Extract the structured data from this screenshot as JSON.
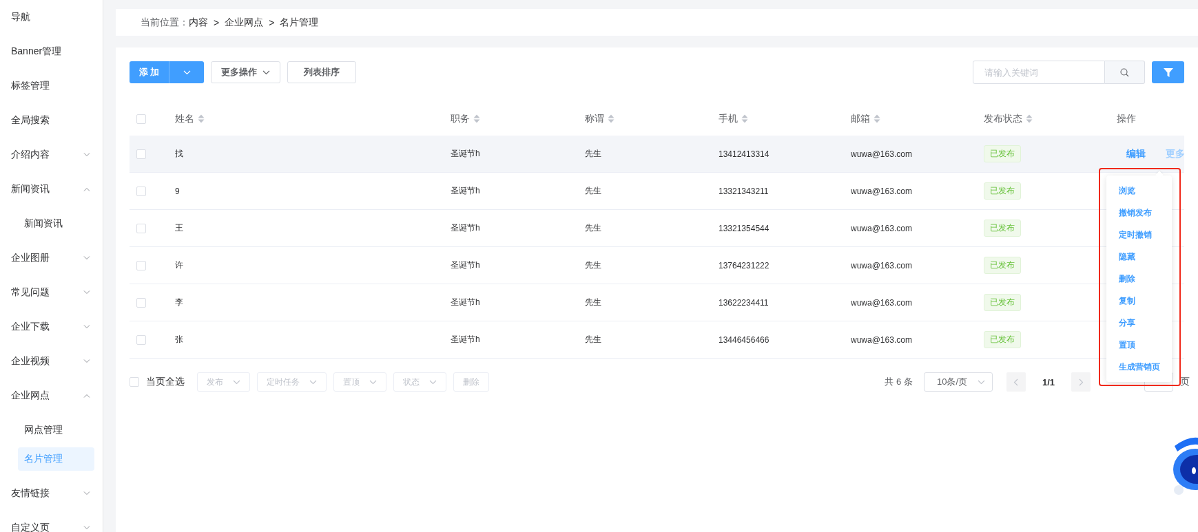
{
  "sidebar": {
    "items": [
      {
        "label": "导航",
        "kind": "link"
      },
      {
        "label": "Banner管理",
        "kind": "link"
      },
      {
        "label": "标签管理",
        "kind": "link"
      },
      {
        "label": "全局搜索",
        "kind": "link"
      },
      {
        "label": "介绍内容",
        "kind": "group",
        "expanded": false
      },
      {
        "label": "新闻资讯",
        "kind": "group",
        "expanded": true,
        "children": [
          {
            "label": "新闻资讯",
            "selected": false
          }
        ]
      },
      {
        "label": "企业图册",
        "kind": "group",
        "expanded": false
      },
      {
        "label": "常见问题",
        "kind": "group",
        "expanded": false
      },
      {
        "label": "企业下载",
        "kind": "group",
        "expanded": false
      },
      {
        "label": "企业视频",
        "kind": "group",
        "expanded": false
      },
      {
        "label": "企业网点",
        "kind": "group",
        "expanded": true,
        "children": [
          {
            "label": "网点管理",
            "selected": false
          },
          {
            "label": "名片管理",
            "selected": true
          }
        ]
      },
      {
        "label": "友情链接",
        "kind": "group",
        "expanded": false
      },
      {
        "label": "自定义页",
        "kind": "group",
        "expanded": false
      }
    ]
  },
  "breadcrumb": {
    "label": "当前位置：",
    "items": [
      "内容",
      "企业网点",
      "名片管理"
    ],
    "separator": ">"
  },
  "toolbar": {
    "add_button": "添 加",
    "more_actions": "更多操作",
    "sort_button": "列表排序",
    "search": {
      "placeholder": "请输入关键词"
    }
  },
  "table": {
    "select_all_checked": false,
    "columns": [
      {
        "label": "姓名",
        "sortable": true
      },
      {
        "label": "职务",
        "sortable": true
      },
      {
        "label": "称谓",
        "sortable": true
      },
      {
        "label": "手机",
        "sortable": true
      },
      {
        "label": "邮箱",
        "sortable": true
      },
      {
        "label": "发布状态",
        "sortable": true
      },
      {
        "label": "操作",
        "sortable": false
      }
    ],
    "rows": [
      {
        "checked": false,
        "hovered": true,
        "cells": [
          "找",
          "圣诞节h",
          "先生",
          "13412413314",
          "wuwa@163.com"
        ],
        "status": "已发布",
        "actions": [
          "编辑",
          "更多"
        ]
      },
      {
        "checked": false,
        "hovered": false,
        "cells": [
          "9",
          "圣诞节h",
          "先生",
          "13321343211",
          "wuwa@163.com"
        ],
        "status": "已发布"
      },
      {
        "checked": false,
        "hovered": false,
        "cells": [
          "王",
          "圣诞节h",
          "先生",
          "13321354544",
          "wuwa@163.com"
        ],
        "status": "已发布"
      },
      {
        "checked": false,
        "hovered": false,
        "cells": [
          "许",
          "圣诞节h",
          "先生",
          "13764231222",
          "wuwa@163.com"
        ],
        "status": "已发布"
      },
      {
        "checked": false,
        "hovered": false,
        "cells": [
          "李",
          "圣诞节h",
          "先生",
          "13622234411",
          "wuwa@163.com"
        ],
        "status": "已发布"
      },
      {
        "checked": false,
        "hovered": false,
        "cells": [
          "张",
          "圣诞节h",
          "先生",
          "13446456466",
          "wuwa@163.com"
        ],
        "status": "已发布"
      }
    ]
  },
  "more_menu": {
    "items": [
      "浏览",
      "撤销发布",
      "定时撤销",
      "隐藏",
      "删除",
      "复制",
      "分享",
      "置顶",
      "生成营销页"
    ]
  },
  "batch_bar": {
    "select_all": {
      "label": "当页全选",
      "checked": false
    },
    "buttons": [
      {
        "label": "发布",
        "kind": "select",
        "disabled": true
      },
      {
        "label": "定时任务",
        "kind": "select",
        "disabled": true
      },
      {
        "label": "置顶",
        "kind": "select",
        "disabled": true
      },
      {
        "label": "状态",
        "kind": "select",
        "disabled": true
      },
      {
        "label": "删除",
        "kind": "button",
        "disabled": true
      }
    ]
  },
  "pagination": {
    "total": "共 6 条",
    "page_size": "10条/页",
    "page": "1/1",
    "suffix": "页"
  }
}
